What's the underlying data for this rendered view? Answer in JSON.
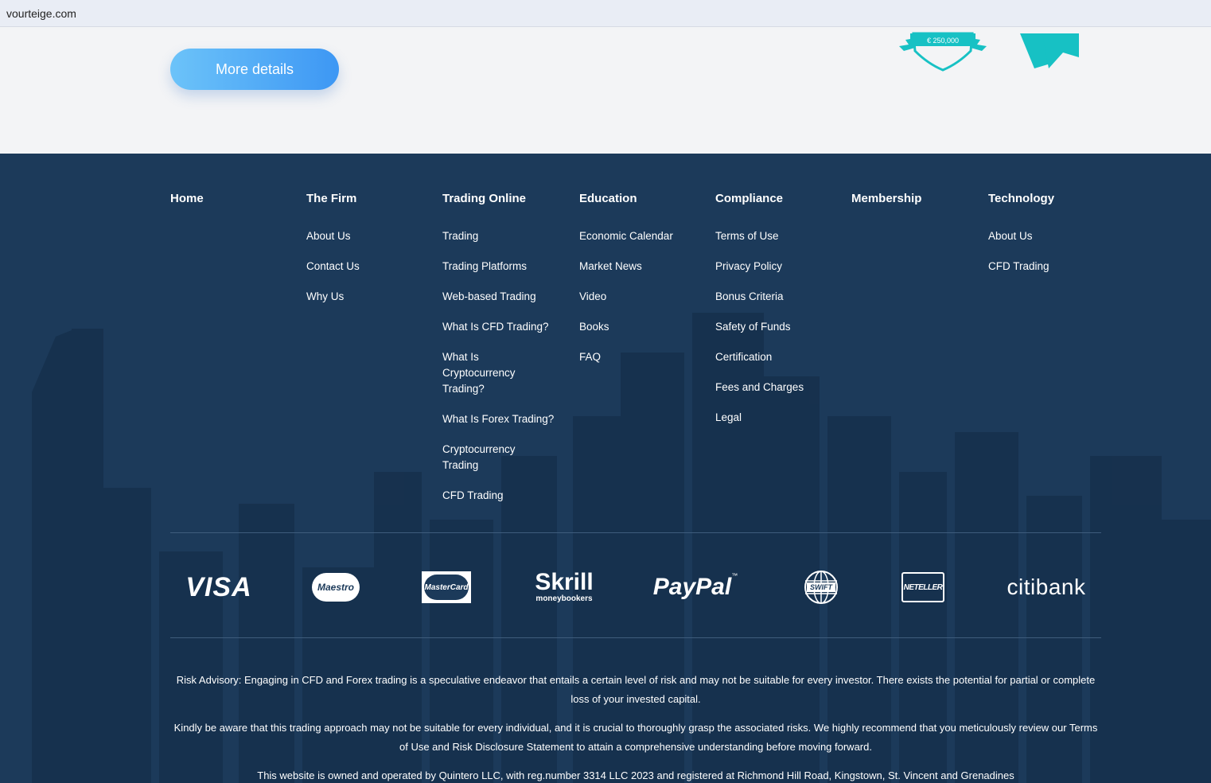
{
  "browser": {
    "url": "vourteige.com"
  },
  "hero": {
    "more_details_label": "More details",
    "badge_amount": "€ 250,000"
  },
  "footer": {
    "columns": [
      {
        "title": "Home",
        "links": []
      },
      {
        "title": "The Firm",
        "links": [
          "About Us",
          "Contact Us",
          "Why Us"
        ]
      },
      {
        "title": "Trading Online",
        "links": [
          "Trading",
          "Trading Platforms",
          "Web-based Trading",
          "What Is CFD Trading?",
          "What Is Cryptocurrency Trading?",
          "What Is Forex Trading?",
          "Cryptocurrency Trading",
          "CFD Trading"
        ]
      },
      {
        "title": "Education",
        "links": [
          "Economic Calendar",
          "Market News",
          "Video",
          "Books",
          "FAQ"
        ]
      },
      {
        "title": "Compliance",
        "links": [
          "Terms of Use",
          "Privacy Policy",
          "Bonus Criteria",
          "Safety of Funds",
          "Certification",
          "Fees and Charges",
          "Legal"
        ]
      },
      {
        "title": "Membership",
        "links": []
      },
      {
        "title": "Technology",
        "links": [
          "About Us",
          "CFD Trading"
        ]
      }
    ],
    "payments": {
      "visa": "VISA",
      "maestro": "Maestro",
      "mastercard": "MasterCard",
      "skrill": "Skrill",
      "skrill_sub": "moneybookers",
      "paypal": "PayPal",
      "paypal_tm": "™",
      "swift": "SWIFT",
      "neteller": "NETELLER",
      "citibank": "citibank"
    },
    "legal": {
      "risk_advisory": "Risk Advisory: Engaging in CFD and Forex trading is a speculative endeavor that entails a certain level of risk and may not be suitable for every investor. There exists the potential for partial or complete loss of your invested capital.",
      "kindly": "Kindly be aware that this trading approach may not be suitable for every individual, and it is crucial to thoroughly grasp the associated risks. We highly recommend that you meticulously review our Terms of Use and Risk Disclosure Statement to attain a comprehensive understanding before moving forward.",
      "ownership": "This website is owned and operated by Quintero LLC, with reg.number 3314 LLC 2023 and registered at Richmond Hill Road, Kingstown, St. Vincent and Grenadines"
    }
  },
  "colors": {
    "footer_bg": "#1c3a5a",
    "button_gradient_start": "#6cc3f9",
    "button_gradient_end": "#3d97f4",
    "badge_teal": "#17c1c4"
  }
}
